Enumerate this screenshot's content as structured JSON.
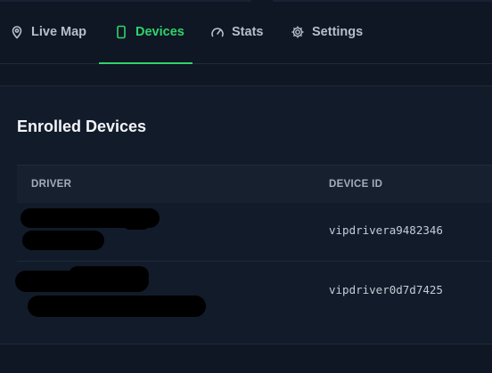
{
  "nav": {
    "tabs": [
      {
        "label": "Live Map",
        "icon": "map-pin-icon",
        "active": false
      },
      {
        "label": "Devices",
        "icon": "smartphone-icon",
        "active": true
      },
      {
        "label": "Stats",
        "icon": "gauge-icon",
        "active": false
      },
      {
        "label": "Settings",
        "icon": "gear-icon",
        "active": false
      }
    ]
  },
  "panel": {
    "title": "Enrolled Devices",
    "table": {
      "columns": [
        "DRIVER",
        "DEVICE ID"
      ],
      "rows": [
        {
          "driver": "",
          "device_id": "vipdrivera9482346"
        },
        {
          "driver": "",
          "device_id": "vipdriver0d7d7425"
        }
      ]
    }
  },
  "colors": {
    "background": "#0f1624",
    "panel": "#121b29",
    "accent": "#2fd46a",
    "muted_text": "#b5bfcc"
  }
}
